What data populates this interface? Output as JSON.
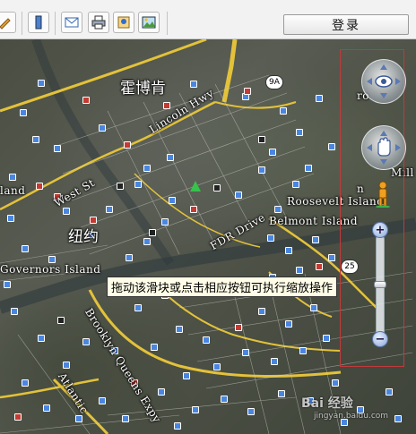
{
  "toolbar": {
    "login_label": "登录",
    "icons": [
      "pencil-icon",
      "panel-icon",
      "mail-icon",
      "print-icon",
      "placemark-icon",
      "image-icon"
    ]
  },
  "map": {
    "labels": {
      "harlem": "霍博肯",
      "lincoln_hwy": "Lincoln Hwy",
      "west_st": "West St",
      "roosevelt": "Roosevelt Island",
      "belmont": "Belmont Island",
      "fdr": "FDR Drive",
      "newyork": "纽约",
      "governors": "Governors Island",
      "bqe": "Brooklyn Queens Expy",
      "atlantic": "Atlantic",
      "mill": "Mill",
      "land": "land",
      "ro": "ro",
      "n": "n"
    },
    "route_shields": {
      "r9a": "9A",
      "r25": "25"
    },
    "tooltip": "拖动该滑块或点击相应按钮可执行缩放操作",
    "zoom": {
      "plus": "+",
      "minus": "−"
    },
    "watermark": "Bai 经验",
    "watermark_url": "jingyan.baidu.com"
  }
}
